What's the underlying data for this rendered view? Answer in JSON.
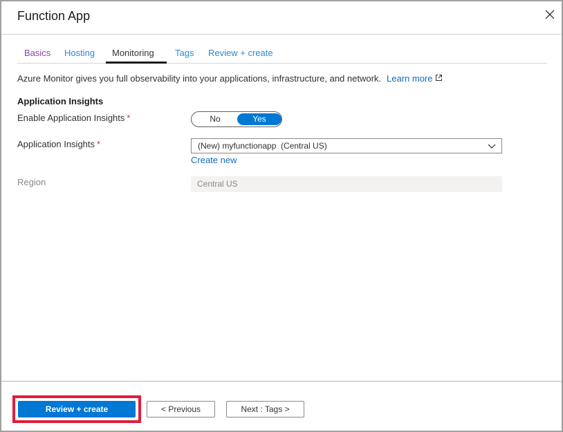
{
  "window": {
    "title": "Function App",
    "close_icon": "close-icon"
  },
  "tabs": [
    {
      "label": "Basics",
      "state": "visited"
    },
    {
      "label": "Hosting",
      "state": "link"
    },
    {
      "label": "Monitoring",
      "state": "active"
    },
    {
      "label": "Tags",
      "state": "link"
    },
    {
      "label": "Review + create",
      "state": "link"
    }
  ],
  "description": {
    "text": "Azure Monitor gives you full observability into your applications, infrastructure, and network.",
    "link_label": "Learn more",
    "link_icon": "external-link-icon"
  },
  "section": {
    "title": "Application Insights"
  },
  "fields": {
    "enable_insights": {
      "label": "Enable Application Insights",
      "required_mark": "*",
      "options": [
        "No",
        "Yes"
      ],
      "selected": "Yes"
    },
    "app_insights": {
      "label": "Application Insights",
      "required_mark": "*",
      "value": "(New) myfunctionapp  (Central US)",
      "create_new_label": "Create new"
    },
    "region": {
      "label": "Region",
      "value": "Central US"
    }
  },
  "footer": {
    "review_create_label": "Review + create",
    "previous_label": "< Previous",
    "next_label": "Next : Tags >"
  },
  "colors": {
    "accent": "#0078d4",
    "link": "#0f6cbd",
    "visited": "#8e3fa8",
    "required": "#d13438",
    "highlight": "#e11d3a"
  }
}
